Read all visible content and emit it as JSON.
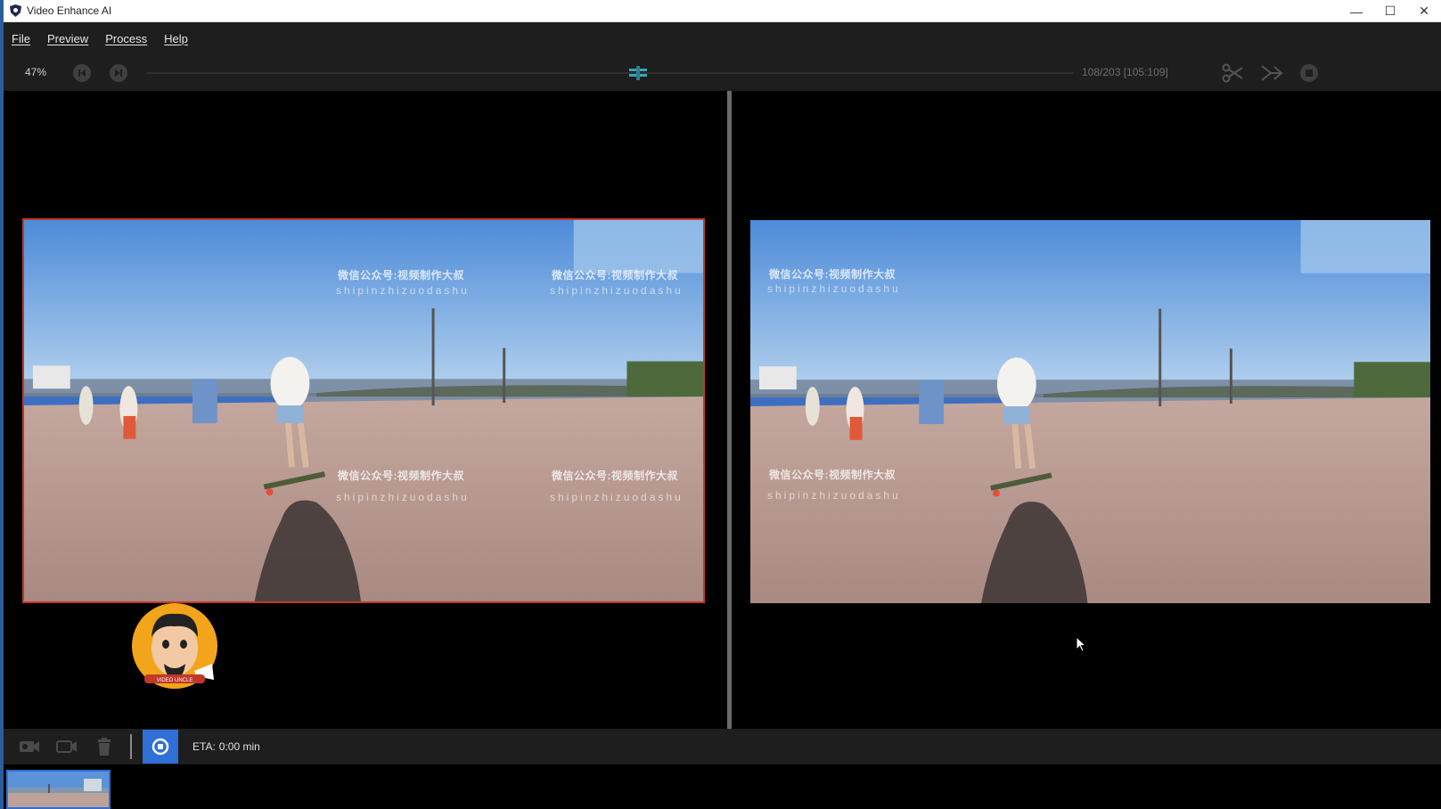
{
  "window": {
    "title": "Video Enhance AI",
    "minimize": "—",
    "maximize": "☐",
    "close": "✕"
  },
  "menu": {
    "file": "File",
    "preview": "Preview",
    "process": "Process",
    "help": "Help"
  },
  "toolbar": {
    "zoom": "47%",
    "frames": "108/203  [105:109]",
    "timeline_position": 0.53
  },
  "watermark": {
    "cn": "微信公众号:视频制作大叔",
    "en": "shipinzhizuodashu",
    "en_cut": "shipinzhizuodash"
  },
  "bottom": {
    "eta_label": "ETA:",
    "eta_value": "0:00 min"
  },
  "avatar": {
    "text": "VIDEO UNCLE"
  },
  "colors": {
    "accent": "#2f6fd6",
    "selection_border": "#c0392b",
    "toolbar_bg": "#1e1e1e"
  }
}
